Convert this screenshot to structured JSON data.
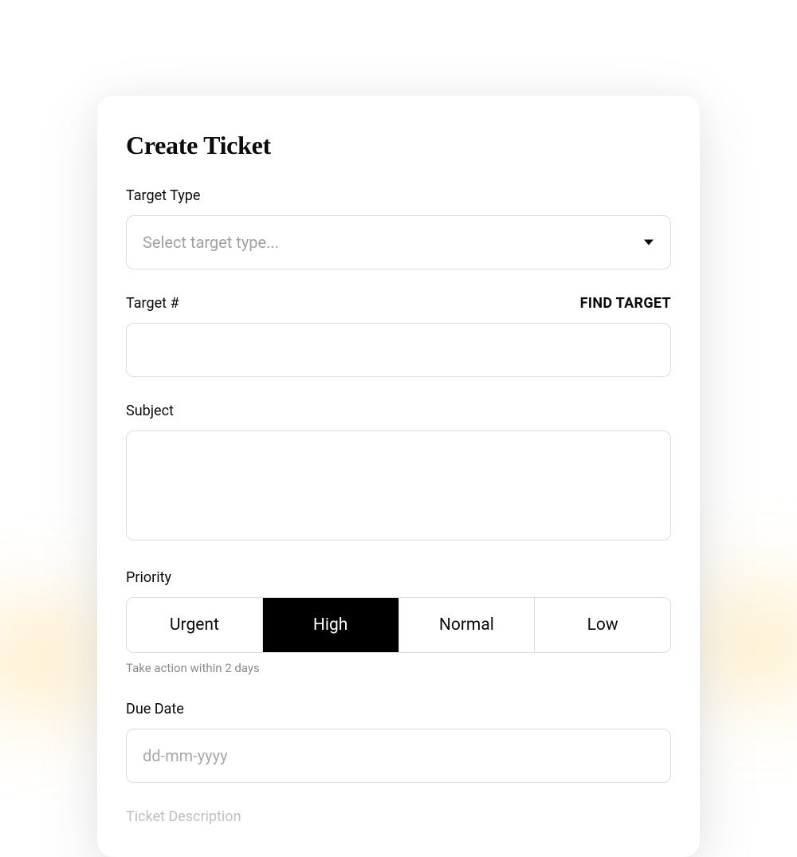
{
  "header": {
    "title": "Create Ticket"
  },
  "fields": {
    "targetType": {
      "label": "Target Type",
      "placeholder": "Select target type..."
    },
    "targetNumber": {
      "label": "Target #",
      "action": "FIND TARGET",
      "value": ""
    },
    "subject": {
      "label": "Subject",
      "value": ""
    },
    "priority": {
      "label": "Priority",
      "options": [
        "Urgent",
        "High",
        "Normal",
        "Low"
      ],
      "selected": "High",
      "helper": "Take action within 2 days"
    },
    "dueDate": {
      "label": "Due Date",
      "placeholder": "dd-mm-yyyy"
    },
    "ticketDescription": {
      "label": "Ticket Description"
    }
  }
}
